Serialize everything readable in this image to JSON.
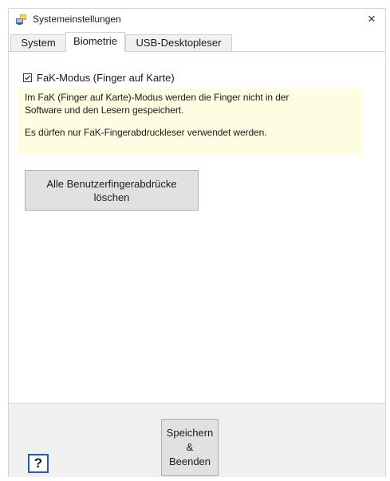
{
  "window": {
    "title": "Systemeinstellungen",
    "close_glyph": "×",
    "icon": "app-settings-icon"
  },
  "tabs": [
    {
      "label": "System",
      "active": false
    },
    {
      "label": "Biometrie",
      "active": true
    },
    {
      "label": "USB-Desktopleser",
      "active": false
    }
  ],
  "biometrie": {
    "fak_mode": {
      "label": "FaK-Modus (Finger auf Karte)",
      "checked": true
    },
    "info": {
      "line1": "Im FaK (Finger auf Karte)-Modus werden die Finger nicht in der",
      "line2": "Software und den Lesern gespeichert.",
      "line3": "Es dürfen nur FaK-Fingerabdruckleser verwendet werden.",
      "background": "#fffde1"
    },
    "delete_button": {
      "line1": "Alle Benutzerfingerabdrücke",
      "line2": "löschen"
    }
  },
  "footer": {
    "help_label": "?",
    "help_border_color": "#1c5fb8",
    "save_button": {
      "line1": "Speichern &",
      "line2": "Beenden"
    }
  }
}
